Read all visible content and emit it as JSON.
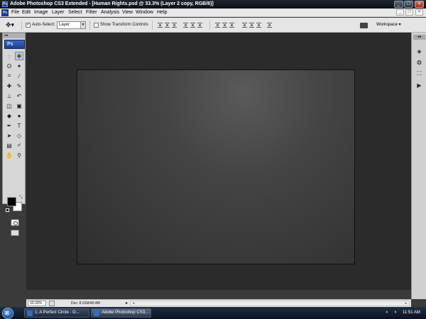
{
  "window": {
    "title": "Adobe Photoshop CS3 Extended - [Human Rights.psd @ 33.3% (Layer 2 copy, RGB/8)]",
    "app_icon": "Ps",
    "controls": [
      "_",
      "□",
      "×"
    ]
  },
  "menubar": {
    "items": [
      "File",
      "Edit",
      "Image",
      "Layer",
      "Select",
      "Filter",
      "Analysis",
      "View",
      "Window",
      "Help"
    ],
    "doc_controls": [
      "_",
      "□",
      "×"
    ]
  },
  "options_bar": {
    "tool_icon": "move-tool-icon",
    "auto_select_label": "Auto-Select:",
    "auto_select_checked": true,
    "auto_select_value": "Layer",
    "show_transform_label": "Show Transform Controls",
    "show_transform_checked": false,
    "workspace_label": "Workspace ▾"
  },
  "tools_panel": {
    "logo": "Ps",
    "grip": "◂◂",
    "tools": [
      {
        "name": "marquee-tool-icon",
        "glyph": "◌"
      },
      {
        "name": "move-tool-icon",
        "glyph": "✥",
        "active": true
      },
      {
        "name": "lasso-tool-icon",
        "glyph": "ʘ"
      },
      {
        "name": "magic-wand-tool-icon",
        "glyph": "✦"
      },
      {
        "name": "crop-tool-icon",
        "glyph": "⌗"
      },
      {
        "name": "slice-tool-icon",
        "glyph": "⁄"
      },
      {
        "name": "healing-brush-tool-icon",
        "glyph": "✚"
      },
      {
        "name": "brush-tool-icon",
        "glyph": "✎"
      },
      {
        "name": "clone-stamp-tool-icon",
        "glyph": "⊥"
      },
      {
        "name": "history-brush-tool-icon",
        "glyph": "↶"
      },
      {
        "name": "eraser-tool-icon",
        "glyph": "◫"
      },
      {
        "name": "gradient-tool-icon",
        "glyph": "▣"
      },
      {
        "name": "blur-tool-icon",
        "glyph": "◆"
      },
      {
        "name": "dodge-tool-icon",
        "glyph": "●"
      },
      {
        "name": "pen-tool-icon",
        "glyph": "✒"
      },
      {
        "name": "type-tool-icon",
        "glyph": "T"
      },
      {
        "name": "path-selection-tool-icon",
        "glyph": "➤"
      },
      {
        "name": "shape-tool-icon",
        "glyph": "◇"
      },
      {
        "name": "notes-tool-icon",
        "glyph": "▤"
      },
      {
        "name": "eyedropper-tool-icon",
        "glyph": "⌿"
      },
      {
        "name": "hand-tool-icon",
        "glyph": "✋"
      },
      {
        "name": "zoom-tool-icon",
        "glyph": "⚲"
      }
    ],
    "foreground_color": "#000000",
    "background_color": "#ffffff",
    "swap_glyph": "⤡"
  },
  "status_bar": {
    "zoom": "33.33%",
    "doc_info": "Doc: 8.01M/40.4M",
    "arrow": "▸"
  },
  "right_dock": {
    "grip": "◂◂",
    "icons": [
      {
        "name": "layers-panel-icon",
        "glyph": "◈"
      },
      {
        "name": "channels-panel-icon",
        "glyph": "❂"
      },
      {
        "name": "paths-panel-icon",
        "glyph": "⛶"
      },
      {
        "name": "actions-panel-icon",
        "glyph": "▶"
      }
    ]
  },
  "taskbar": {
    "start_glyph": "⊞",
    "buttons": [
      {
        "label": "1: A Perfect Circle - O...",
        "active": false
      },
      {
        "label": "Adobe Photoshop CS3...",
        "active": true
      }
    ],
    "tray_icons": [
      "speaker-icon",
      "network-icon"
    ],
    "tray_glyphs": [
      "◐",
      "◑"
    ],
    "clock": "11:51 AM"
  },
  "colors": {
    "workspace_bg": "#2b2b2b",
    "canvas_highlight": "#5a5a5a",
    "ps_blue": "#1c3f8a"
  }
}
